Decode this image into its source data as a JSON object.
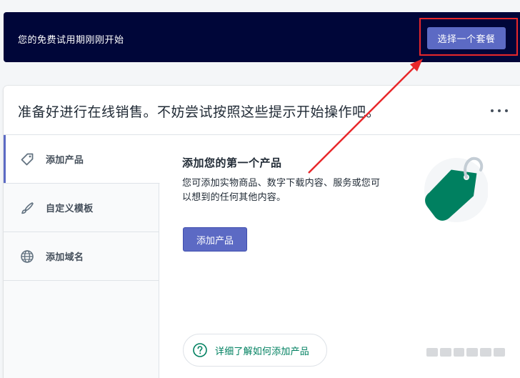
{
  "banner": {
    "trial_text": "您的免费试用期刚刚开始",
    "plan_button_label": "选择一个套餐"
  },
  "card": {
    "heading": "准备好进行在线销售。不妨尝试按照这些提示开始操作吧。",
    "more_icon": "more-horizontal-icon"
  },
  "steps": [
    {
      "label": "添加产品",
      "icon": "tag-icon",
      "active": true
    },
    {
      "label": "自定义模板",
      "icon": "brush-icon",
      "active": false
    },
    {
      "label": "添加域名",
      "icon": "globe-icon",
      "active": false
    }
  ],
  "content": {
    "title": "添加您的第一个产品",
    "description": "您可添加实物商品、数字下载内容、服务或您可以想到的任何其他内容。",
    "button_label": "添加产品",
    "learn_more_label": "详细了解如何添加产品",
    "learn_more_icon": "question-circle-icon",
    "illustration_icon": "price-tag-icon"
  },
  "colors": {
    "banner_bg": "#000639",
    "primary": "#5c6ac4",
    "tag_green": "#008060",
    "annotation_red": "#e8272a"
  }
}
